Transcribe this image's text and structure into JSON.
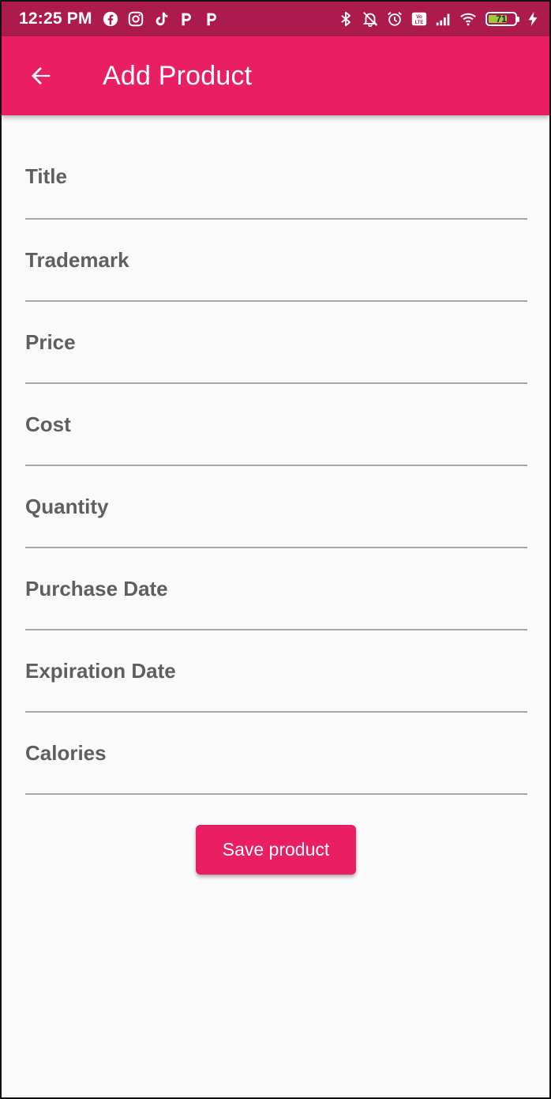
{
  "status_bar": {
    "time": "12:25 PM",
    "left_icons": [
      "facebook-icon",
      "instagram-icon",
      "tiktok-icon",
      "p-app-icon",
      "p-app-icon"
    ],
    "right_icons": [
      "bluetooth-icon",
      "notifications-off-icon",
      "alarm-icon",
      "volte-icon",
      "signal-icon",
      "wifi-icon"
    ],
    "volte_label": "Vo LTE",
    "battery_level": "71",
    "battery_fill_percent": 71,
    "battery_color": "#9ccc3a"
  },
  "app_bar": {
    "title": "Add Product",
    "back_icon": "arrow-back-icon",
    "color": "#e91e63"
  },
  "form": {
    "fields": [
      {
        "label": "Title"
      },
      {
        "label": "Trademark"
      },
      {
        "label": "Price"
      },
      {
        "label": "Cost"
      },
      {
        "label": "Quantity"
      },
      {
        "label": "Purchase Date"
      },
      {
        "label": "Expiration Date"
      },
      {
        "label": "Calories"
      }
    ],
    "save_label": "Save product"
  }
}
